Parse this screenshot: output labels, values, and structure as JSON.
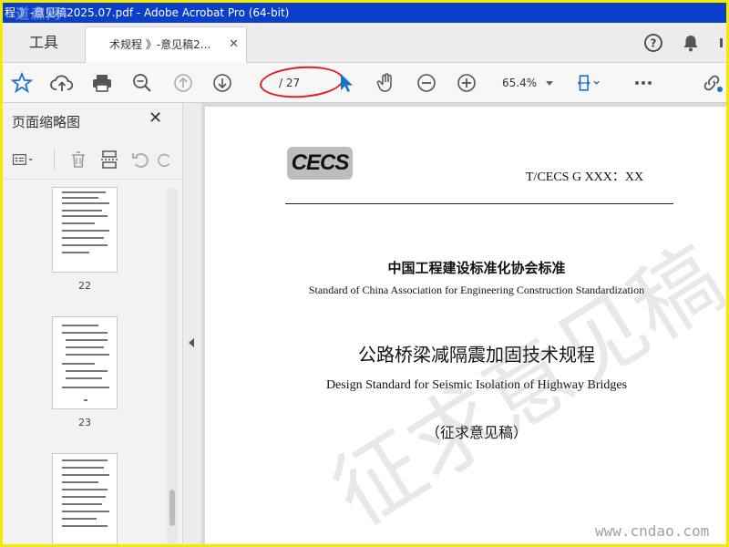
{
  "window": {
    "title": "程 》-意见稿2025.07.pdf - Adobe Acrobat Pro (64-bit)",
    "watermark_logo": "道森网"
  },
  "tabs": {
    "tools_label": "工具",
    "document_label": "术规程 》-意见稿2...",
    "close_glyph": "✕"
  },
  "toolbar": {
    "page_indicator": "/ 27",
    "zoom_level": "65.4%"
  },
  "sidebar": {
    "title": "页面缩略图",
    "close_glyph": "✕",
    "thumbnails": [
      {
        "page_label": "22"
      },
      {
        "page_label": "23"
      },
      {
        "page_label": ""
      }
    ]
  },
  "document": {
    "logo_text": "CECS",
    "standard_code": "T/CECS G XXX：XX",
    "org_cn": "中国工程建设标准化协会标准",
    "org_en": "Standard of China Association for Engineering Construction Standardization",
    "title_cn": "公路桥梁减隔震加固技术规程",
    "title_en": "Design Standard for Seismic Isolation of Highway Bridges",
    "status_cn": "（征求意见稿）",
    "watermark_text": "征求意见稿"
  },
  "site_watermark": "www.cndao.com",
  "colors": {
    "titlebar_blue": "#0b3ec9",
    "frame_yellow": "#f3ea00",
    "annotation_red": "#e02020",
    "icon_blue": "#1a73c9"
  }
}
